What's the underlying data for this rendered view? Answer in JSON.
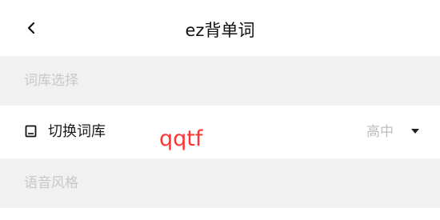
{
  "header": {
    "back_icon": "chevron-left-icon",
    "title": "ez背单词"
  },
  "sections": [
    {
      "label": "词库选择"
    },
    {
      "label": "语音风格"
    }
  ],
  "wordbank_row": {
    "icon": "book-icon",
    "label": "切换词库",
    "overlay_text": "qqtf",
    "value": "高中",
    "dropdown_icon": "caret-down-icon"
  },
  "colors": {
    "section_bg": "#f1f1f1",
    "overlay_text": "#ff3333",
    "muted_text": "#bdbdbd"
  }
}
